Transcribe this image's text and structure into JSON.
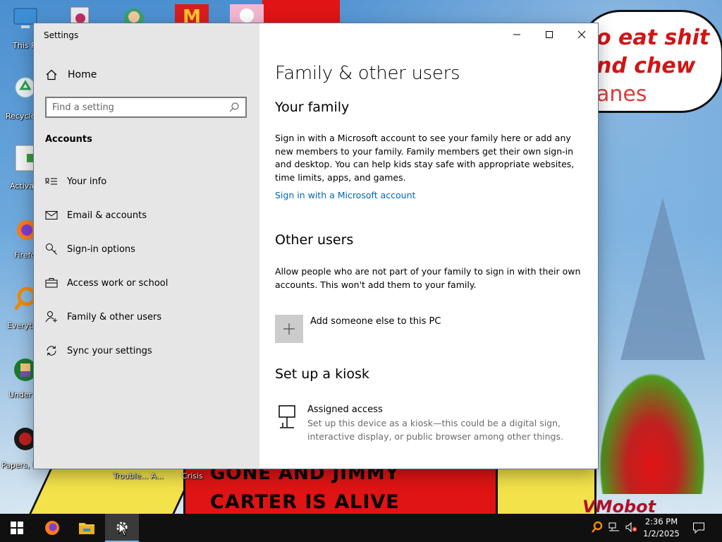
{
  "desktop": {
    "icons": [
      {
        "label": "This P"
      },
      {
        "label": "Recycle"
      },
      {
        "label": "Activa"
      },
      {
        "label": "Firefo"
      },
      {
        "label": "Everyth"
      },
      {
        "label": "Under"
      },
      {
        "label": "Papers, P"
      }
    ],
    "bottom_labels": [
      "Trouble... A...",
      "Crisis"
    ],
    "speech_lines": [
      "o eat shit",
      "nd chew",
      "anes"
    ],
    "wallpaper_text": [
      "GONE AND JIMMY",
      "CARTER IS ALIVE"
    ],
    "signature": "VMobot"
  },
  "window": {
    "title": "Settings"
  },
  "sidebar": {
    "home_label": "Home",
    "search_placeholder": "Find a setting",
    "section_title": "Accounts",
    "items": [
      {
        "label": "Your info",
        "icon": "contact-card-icon"
      },
      {
        "label": "Email & accounts",
        "icon": "mail-icon"
      },
      {
        "label": "Sign-in options",
        "icon": "key-icon"
      },
      {
        "label": "Access work or school",
        "icon": "briefcase-icon"
      },
      {
        "label": "Family & other users",
        "icon": "person-add-icon"
      },
      {
        "label": "Sync your settings",
        "icon": "sync-icon"
      }
    ]
  },
  "content": {
    "page_title": "Family & other users",
    "your_family": {
      "heading": "Your family",
      "description": "Sign in with a Microsoft account to see your family here or add any new members to your family. Family members get their own sign-in and desktop. You can help kids stay safe with appropriate websites, time limits, apps, and games.",
      "link": "Sign in with a Microsoft account"
    },
    "other_users": {
      "heading": "Other users",
      "description": "Allow people who are not part of your family to sign in with their own accounts. This won't add them to your family.",
      "add_label": "Add someone else to this PC"
    },
    "kiosk": {
      "heading": "Set up a kiosk",
      "title": "Assigned access",
      "description": "Set up this device as a kiosk—this could be a digital sign, interactive display, or public browser among other things."
    }
  },
  "taskbar": {
    "time": "2:36 PM",
    "date": "1/2/2025"
  }
}
